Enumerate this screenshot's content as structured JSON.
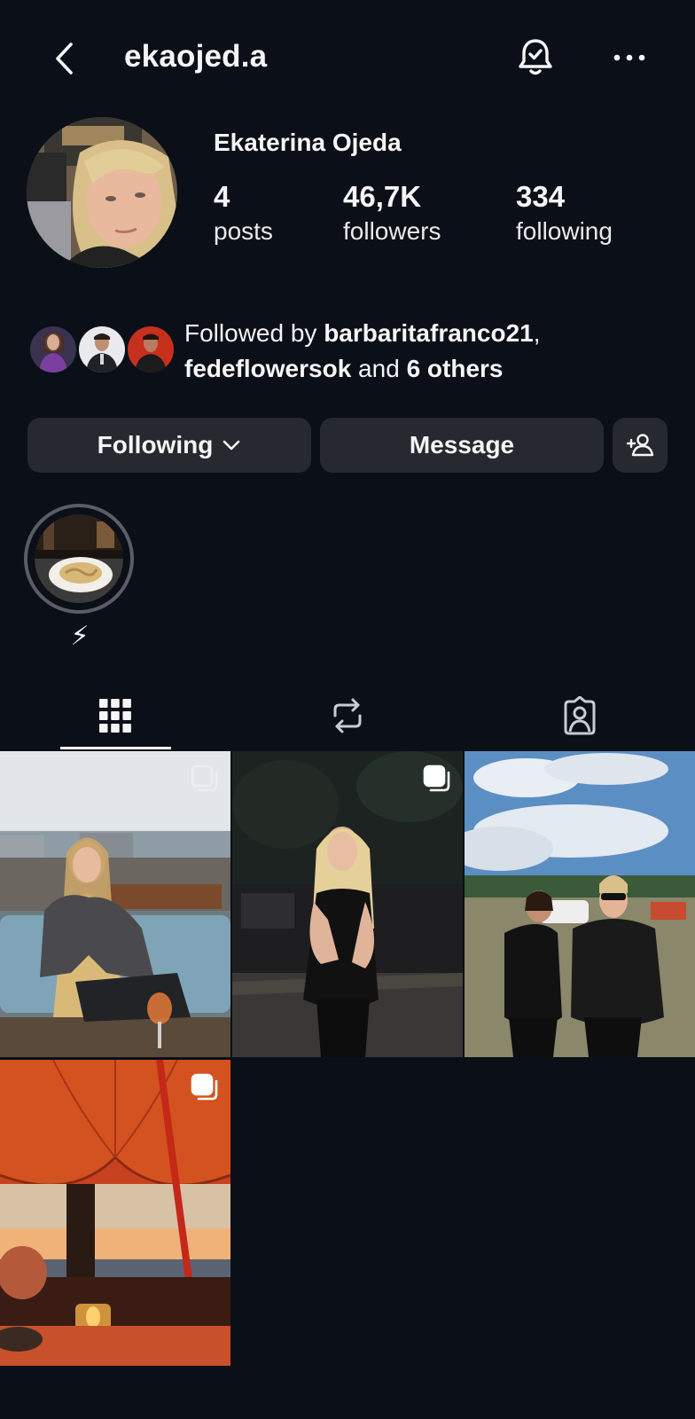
{
  "header": {
    "username": "ekaojed.a",
    "back_icon": "chevron-left-icon",
    "bell_icon": "bell-check-icon",
    "more_icon": "more-horizontal-icon"
  },
  "profile": {
    "full_name": "Ekaterina Ojeda",
    "stats": {
      "posts": {
        "count": "4",
        "label": "posts"
      },
      "followers": {
        "count": "46,7K",
        "label": "followers"
      },
      "following": {
        "count": "334",
        "label": "following"
      }
    }
  },
  "followed_by": {
    "prefix": "Followed by ",
    "user1": "barbaritafranco21",
    "separator": ",",
    "user2": "fedeflowersok",
    "middle": " and ",
    "others": "6 others"
  },
  "actions": {
    "following_label": "Following",
    "message_label": "Message"
  },
  "highlights": [
    {
      "label": "⚡"
    }
  ],
  "tabs": [
    {
      "name": "posts-grid",
      "icon": "grid-icon",
      "active": true
    },
    {
      "name": "reposts",
      "icon": "repost-icon",
      "active": false
    },
    {
      "name": "tagged",
      "icon": "tagged-user-icon",
      "active": false
    }
  ],
  "posts": [
    {
      "id": "post-1",
      "multiple": true
    },
    {
      "id": "post-2",
      "multiple": true
    },
    {
      "id": "post-3",
      "multiple": false
    },
    {
      "id": "post-4",
      "multiple": true
    }
  ],
  "colors": {
    "background": "#0b0f18",
    "button": "#26292f",
    "text": "#f5f5f5"
  }
}
